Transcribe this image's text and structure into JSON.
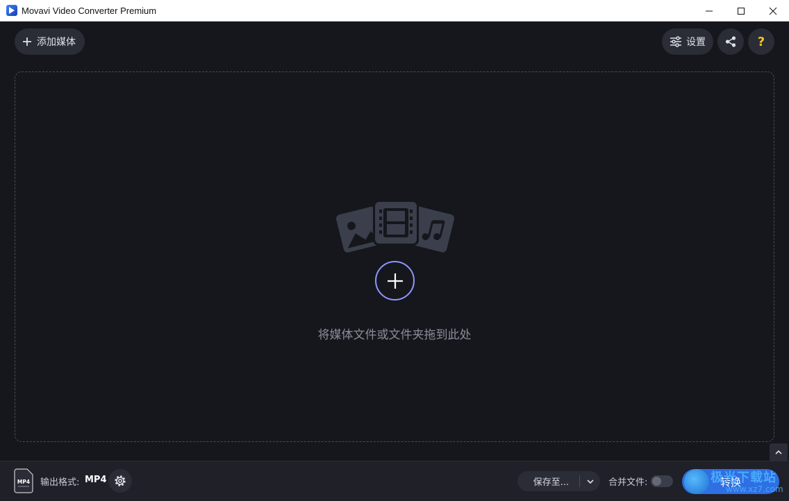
{
  "window": {
    "title": "Movavi Video Converter Premium"
  },
  "toolbar": {
    "add_media_label": "添加媒体",
    "settings_label": "设置",
    "help_label": "?"
  },
  "dropzone": {
    "hint": "将媒体文件或文件夹拖到此处"
  },
  "bottom": {
    "format_icon_text": "MP4",
    "format_label": "输出格式:",
    "format_value": "MP4",
    "save_to_label": "保存至...",
    "merge_label": "合并文件:",
    "merge_enabled": false,
    "convert_label": "转换"
  },
  "watermark": {
    "text": "极光下载站",
    "url": "www.xz7.com"
  },
  "colors": {
    "background": "#16171d",
    "panel": "#2a2c36",
    "accent": "#2e6fe3",
    "add_ring": "#8f96ff",
    "help_icon": "#f5c518"
  }
}
